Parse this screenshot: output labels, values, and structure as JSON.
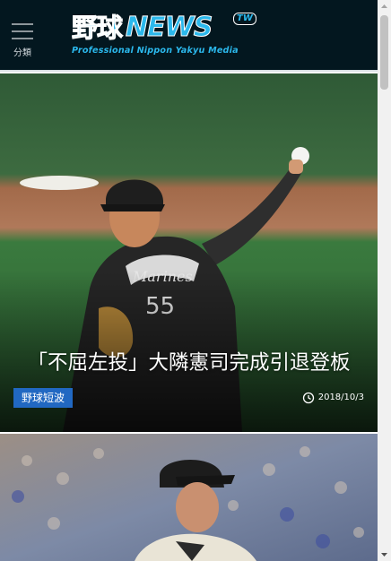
{
  "header": {
    "menu_label": "分類",
    "logo": {
      "main_kanji": "野球",
      "main_latin": "NEWS",
      "badge": "TW",
      "tagline": "Professional Nippon Yakyu Media"
    }
  },
  "articles": [
    {
      "title": "「不屈左投」大隣憲司完成引退登板",
      "category": "野球短波",
      "date": "2018/10/3"
    },
    {
      "title": "",
      "category": "",
      "date": ""
    }
  ],
  "colors": {
    "header_bg": "#03171f",
    "logo_blue": "#2bb8ec",
    "category_bg": "#2168c2"
  },
  "icons": {
    "menu": "hamburger-icon",
    "date": "clock-icon"
  }
}
